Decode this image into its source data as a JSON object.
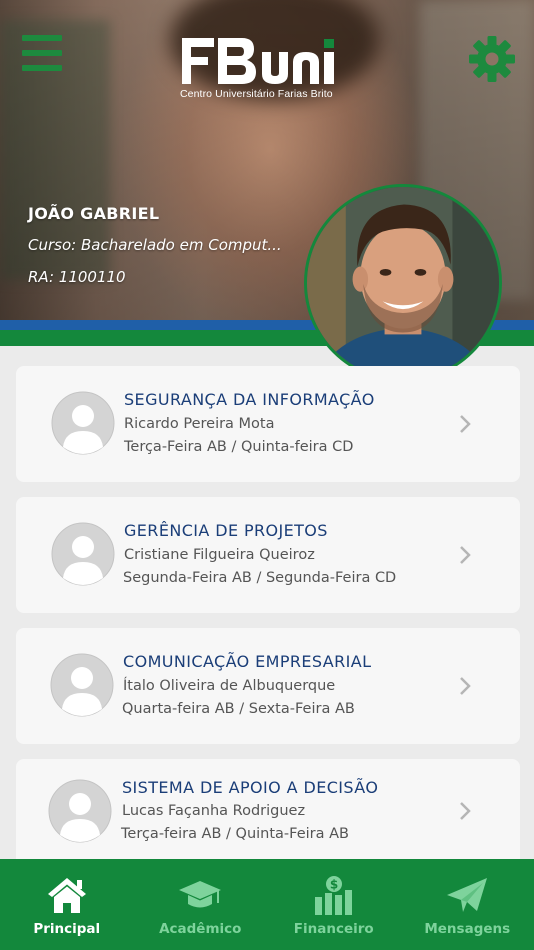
{
  "app": {
    "logo_text": "FBuni",
    "logo_subtitle": "Centro Universitário Farias Brito"
  },
  "header": {
    "menu_icon": "hamburger-menu-icon",
    "settings_icon": "gear-icon"
  },
  "student": {
    "name": "JOÃO GABRIEL",
    "course": "Curso: Bacharelado em Comput...",
    "ra": "RA: 1100110"
  },
  "courses": [
    {
      "title": "SEGURANÇA DA INFORMAÇÃO",
      "teacher": "Ricardo Pereira Mota",
      "schedule": "Terça-Feira AB / Quinta-feira CD"
    },
    {
      "title": "GERÊNCIA DE PROJETOS",
      "teacher": "Cristiane Filgueira Queiroz",
      "schedule": "Segunda-Feira AB / Segunda-Feira CD"
    },
    {
      "title": "COMUNICAÇÃO EMPRESARIAL",
      "teacher": "Ítalo Oliveira de Albuquerque",
      "schedule": "Quarta-feira AB / Sexta-Feira AB"
    },
    {
      "title": "SISTEMA DE APOIO A DECISÃO",
      "teacher": "Lucas Façanha Rodriguez",
      "schedule": "Terça-feira AB / Quinta-Feira AB"
    }
  ],
  "nav": {
    "items": [
      {
        "label": "Principal",
        "icon": "home-icon",
        "active": true
      },
      {
        "label": "Acadêmico",
        "icon": "graduation-cap-icon",
        "active": false
      },
      {
        "label": "Financeiro",
        "icon": "finance-chart-icon",
        "active": false
      },
      {
        "label": "Mensagens",
        "icon": "paper-plane-icon",
        "active": false
      }
    ]
  },
  "colors": {
    "brand_green": "#13883c",
    "brand_blue": "#1f5fa8",
    "title_blue": "#1b3e78",
    "nav_inactive": "#7ed39c"
  }
}
